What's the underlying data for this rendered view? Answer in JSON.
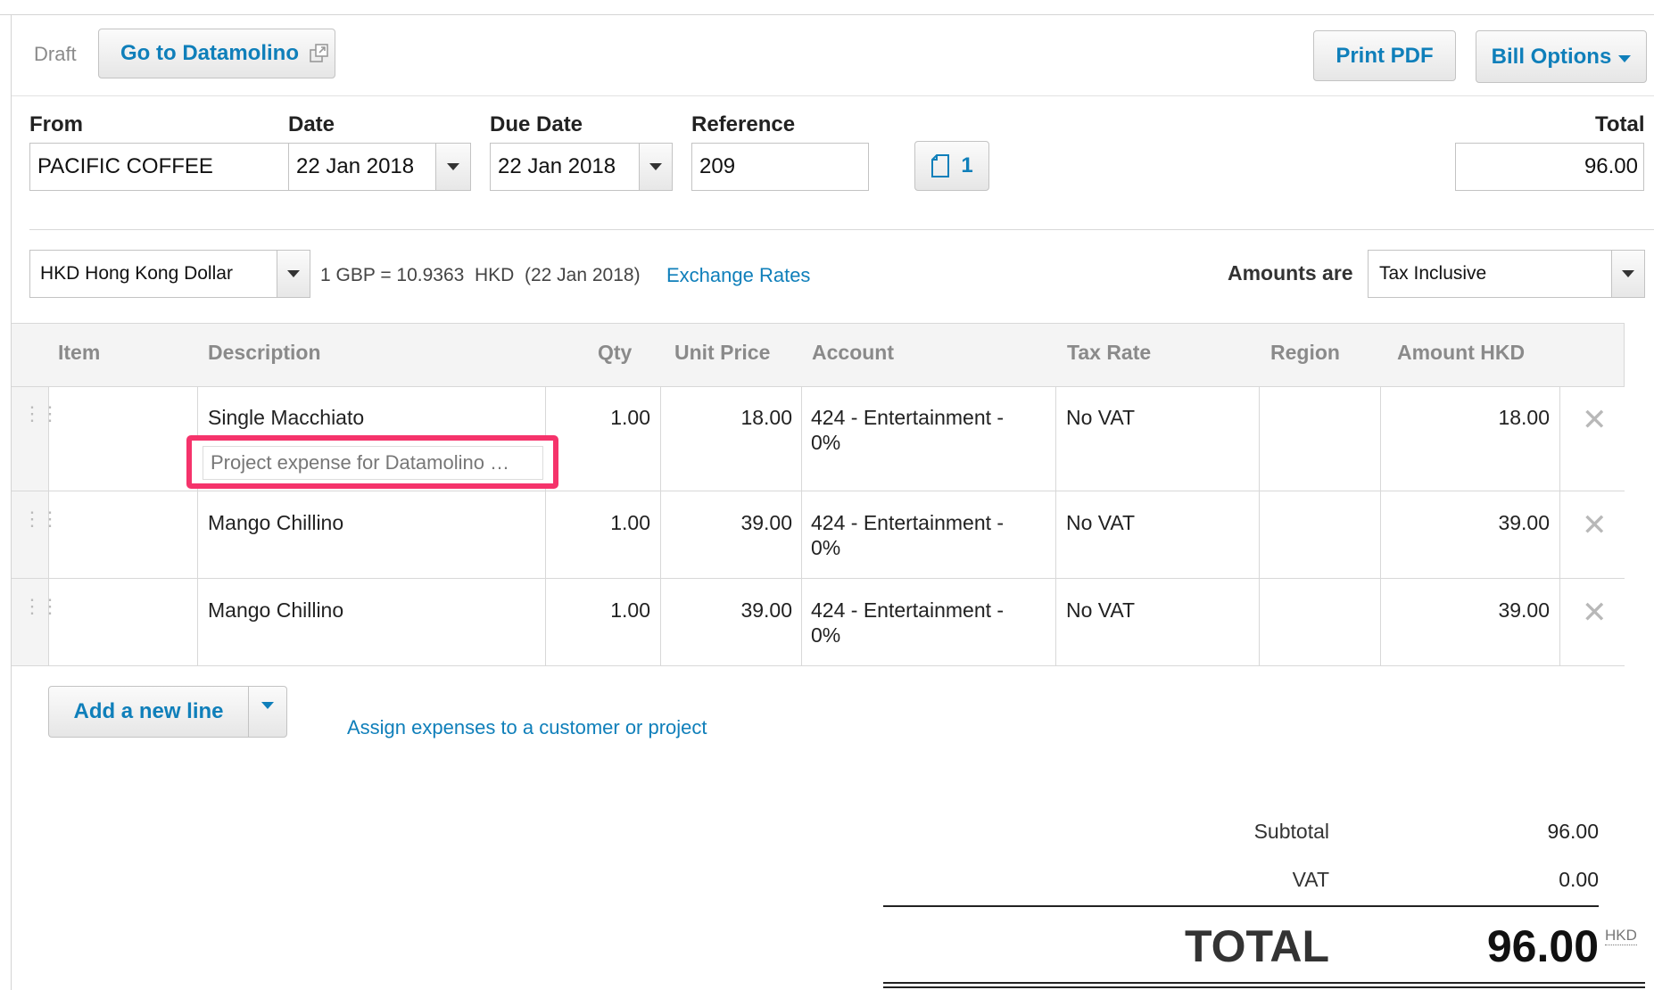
{
  "header": {
    "status": "Draft",
    "go_to_label": "Go to Datamolino",
    "print_pdf_label": "Print PDF",
    "bill_options_label": "Bill Options"
  },
  "fields": {
    "from_label": "From",
    "from_value": "PACIFIC COFFEE",
    "date_label": "Date",
    "date_value": "22 Jan 2018",
    "due_date_label": "Due Date",
    "due_date_value": "22 Jan 2018",
    "reference_label": "Reference",
    "reference_value": "209",
    "attachments_count": "1",
    "total_label": "Total",
    "total_value": "96.00"
  },
  "currency": {
    "selected": "HKD Hong Kong Dollar",
    "rate_text": "1 GBP = 10.9363  HKD  (22 Jan 2018)",
    "exchange_rates_link": "Exchange Rates",
    "amounts_are_label": "Amounts are",
    "amounts_are_value": "Tax Inclusive"
  },
  "table": {
    "headers": {
      "item": "Item",
      "description": "Description",
      "qty": "Qty",
      "unit_price": "Unit Price",
      "account": "Account",
      "tax_rate": "Tax Rate",
      "region": "Region",
      "amount": "Amount HKD"
    },
    "rows": [
      {
        "item": "",
        "description": "Single Macchiato",
        "note": "Project expense for Datamolino …",
        "qty": "1.00",
        "unit_price": "18.00",
        "account_line1": "424 - Entertainment -",
        "account_line2": "0%",
        "tax_rate": "No VAT",
        "region": "",
        "amount": "18.00"
      },
      {
        "item": "",
        "description": "Mango Chillino",
        "qty": "1.00",
        "unit_price": "39.00",
        "account_line1": "424 - Entertainment -",
        "account_line2": "0%",
        "tax_rate": "No VAT",
        "region": "",
        "amount": "39.00"
      },
      {
        "item": "",
        "description": "Mango Chillino",
        "qty": "1.00",
        "unit_price": "39.00",
        "account_line1": "424 - Entertainment -",
        "account_line2": "0%",
        "tax_rate": "No VAT",
        "region": "",
        "amount": "39.00"
      }
    ]
  },
  "actions": {
    "add_line_label": "Add a new line",
    "assign_link": "Assign expenses to a customer or project"
  },
  "totals": {
    "subtotal_label": "Subtotal",
    "subtotal_value": "96.00",
    "vat_label": "VAT",
    "vat_value": "0.00",
    "total_label": "TOTAL",
    "total_value": "96.00",
    "currency": "HKD"
  },
  "colors": {
    "accent": "#0f7fba",
    "highlight": "#f5336b"
  },
  "icons": {
    "external": "external-link-icon",
    "attachment": "document-icon",
    "drag": "drag-handle-icon",
    "delete": "close-icon"
  }
}
